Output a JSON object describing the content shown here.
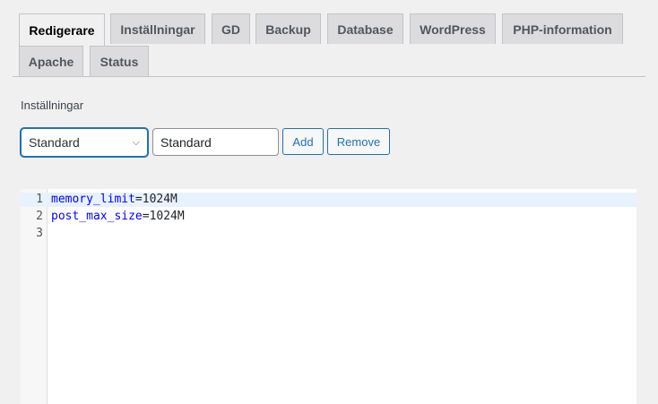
{
  "tabs": [
    {
      "label": "Redigerare",
      "active": true
    },
    {
      "label": "Inställningar"
    },
    {
      "label": "GD"
    },
    {
      "label": "Backup"
    },
    {
      "label": "Database"
    },
    {
      "label": "WordPress"
    },
    {
      "label": "PHP-information"
    },
    {
      "label": "Apache"
    },
    {
      "label": "Status"
    }
  ],
  "settings": {
    "label": "Inställningar",
    "select_value": "Standard",
    "name_value": "Standard",
    "add_label": "Add",
    "remove_label": "Remove"
  },
  "editor": {
    "lines": [
      {
        "num": "1",
        "key": "memory_limit",
        "value": "=1024M"
      },
      {
        "num": "2",
        "key": "post_max_size",
        "value": "=1024M"
      },
      {
        "num": "3",
        "key": "",
        "value": ""
      }
    ]
  }
}
